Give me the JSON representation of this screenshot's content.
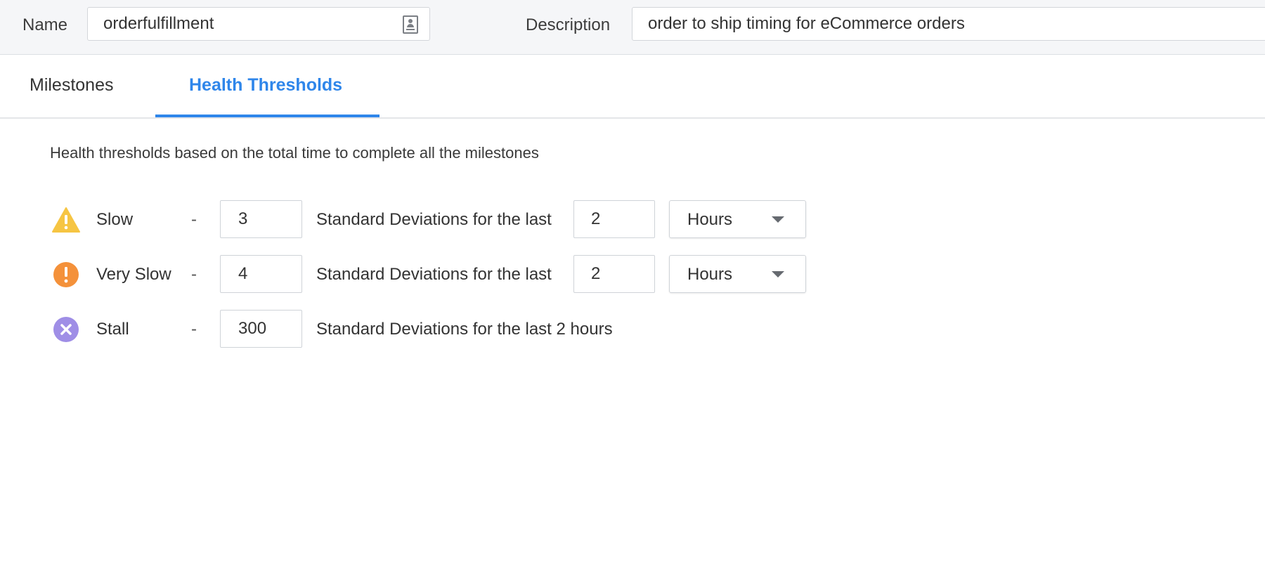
{
  "header": {
    "name_label": "Name",
    "name_value": "orderfulfillment",
    "description_label": "Description",
    "description_value": "order to ship timing for eCommerce orders"
  },
  "tabs": [
    {
      "label": "Milestones",
      "active": false
    },
    {
      "label": "Health Thresholds",
      "active": true
    }
  ],
  "intro": "Health thresholds based on the total time to complete all the milestones",
  "thresholds": [
    {
      "level": "Slow",
      "icon": "warning-triangle-icon",
      "icon_color": "#f6c543",
      "dash": "-",
      "std_devs": "3",
      "text": "Standard Deviations for the last",
      "window": "2",
      "unit": "Hours"
    },
    {
      "level": "Very Slow",
      "icon": "exclamation-circle-icon",
      "icon_color": "#f4913a",
      "dash": "-",
      "std_devs": "4",
      "text": "Standard Deviations for the last",
      "window": "2",
      "unit": "Hours"
    },
    {
      "level": "Stall",
      "icon": "x-circle-icon",
      "icon_color": "#9f8ee6",
      "dash": "-",
      "std_devs": "300",
      "text": "Standard Deviations for the last 2 hours"
    }
  ],
  "colors": {
    "accent": "#2f86ea",
    "header_bg": "#f5f6f8"
  }
}
